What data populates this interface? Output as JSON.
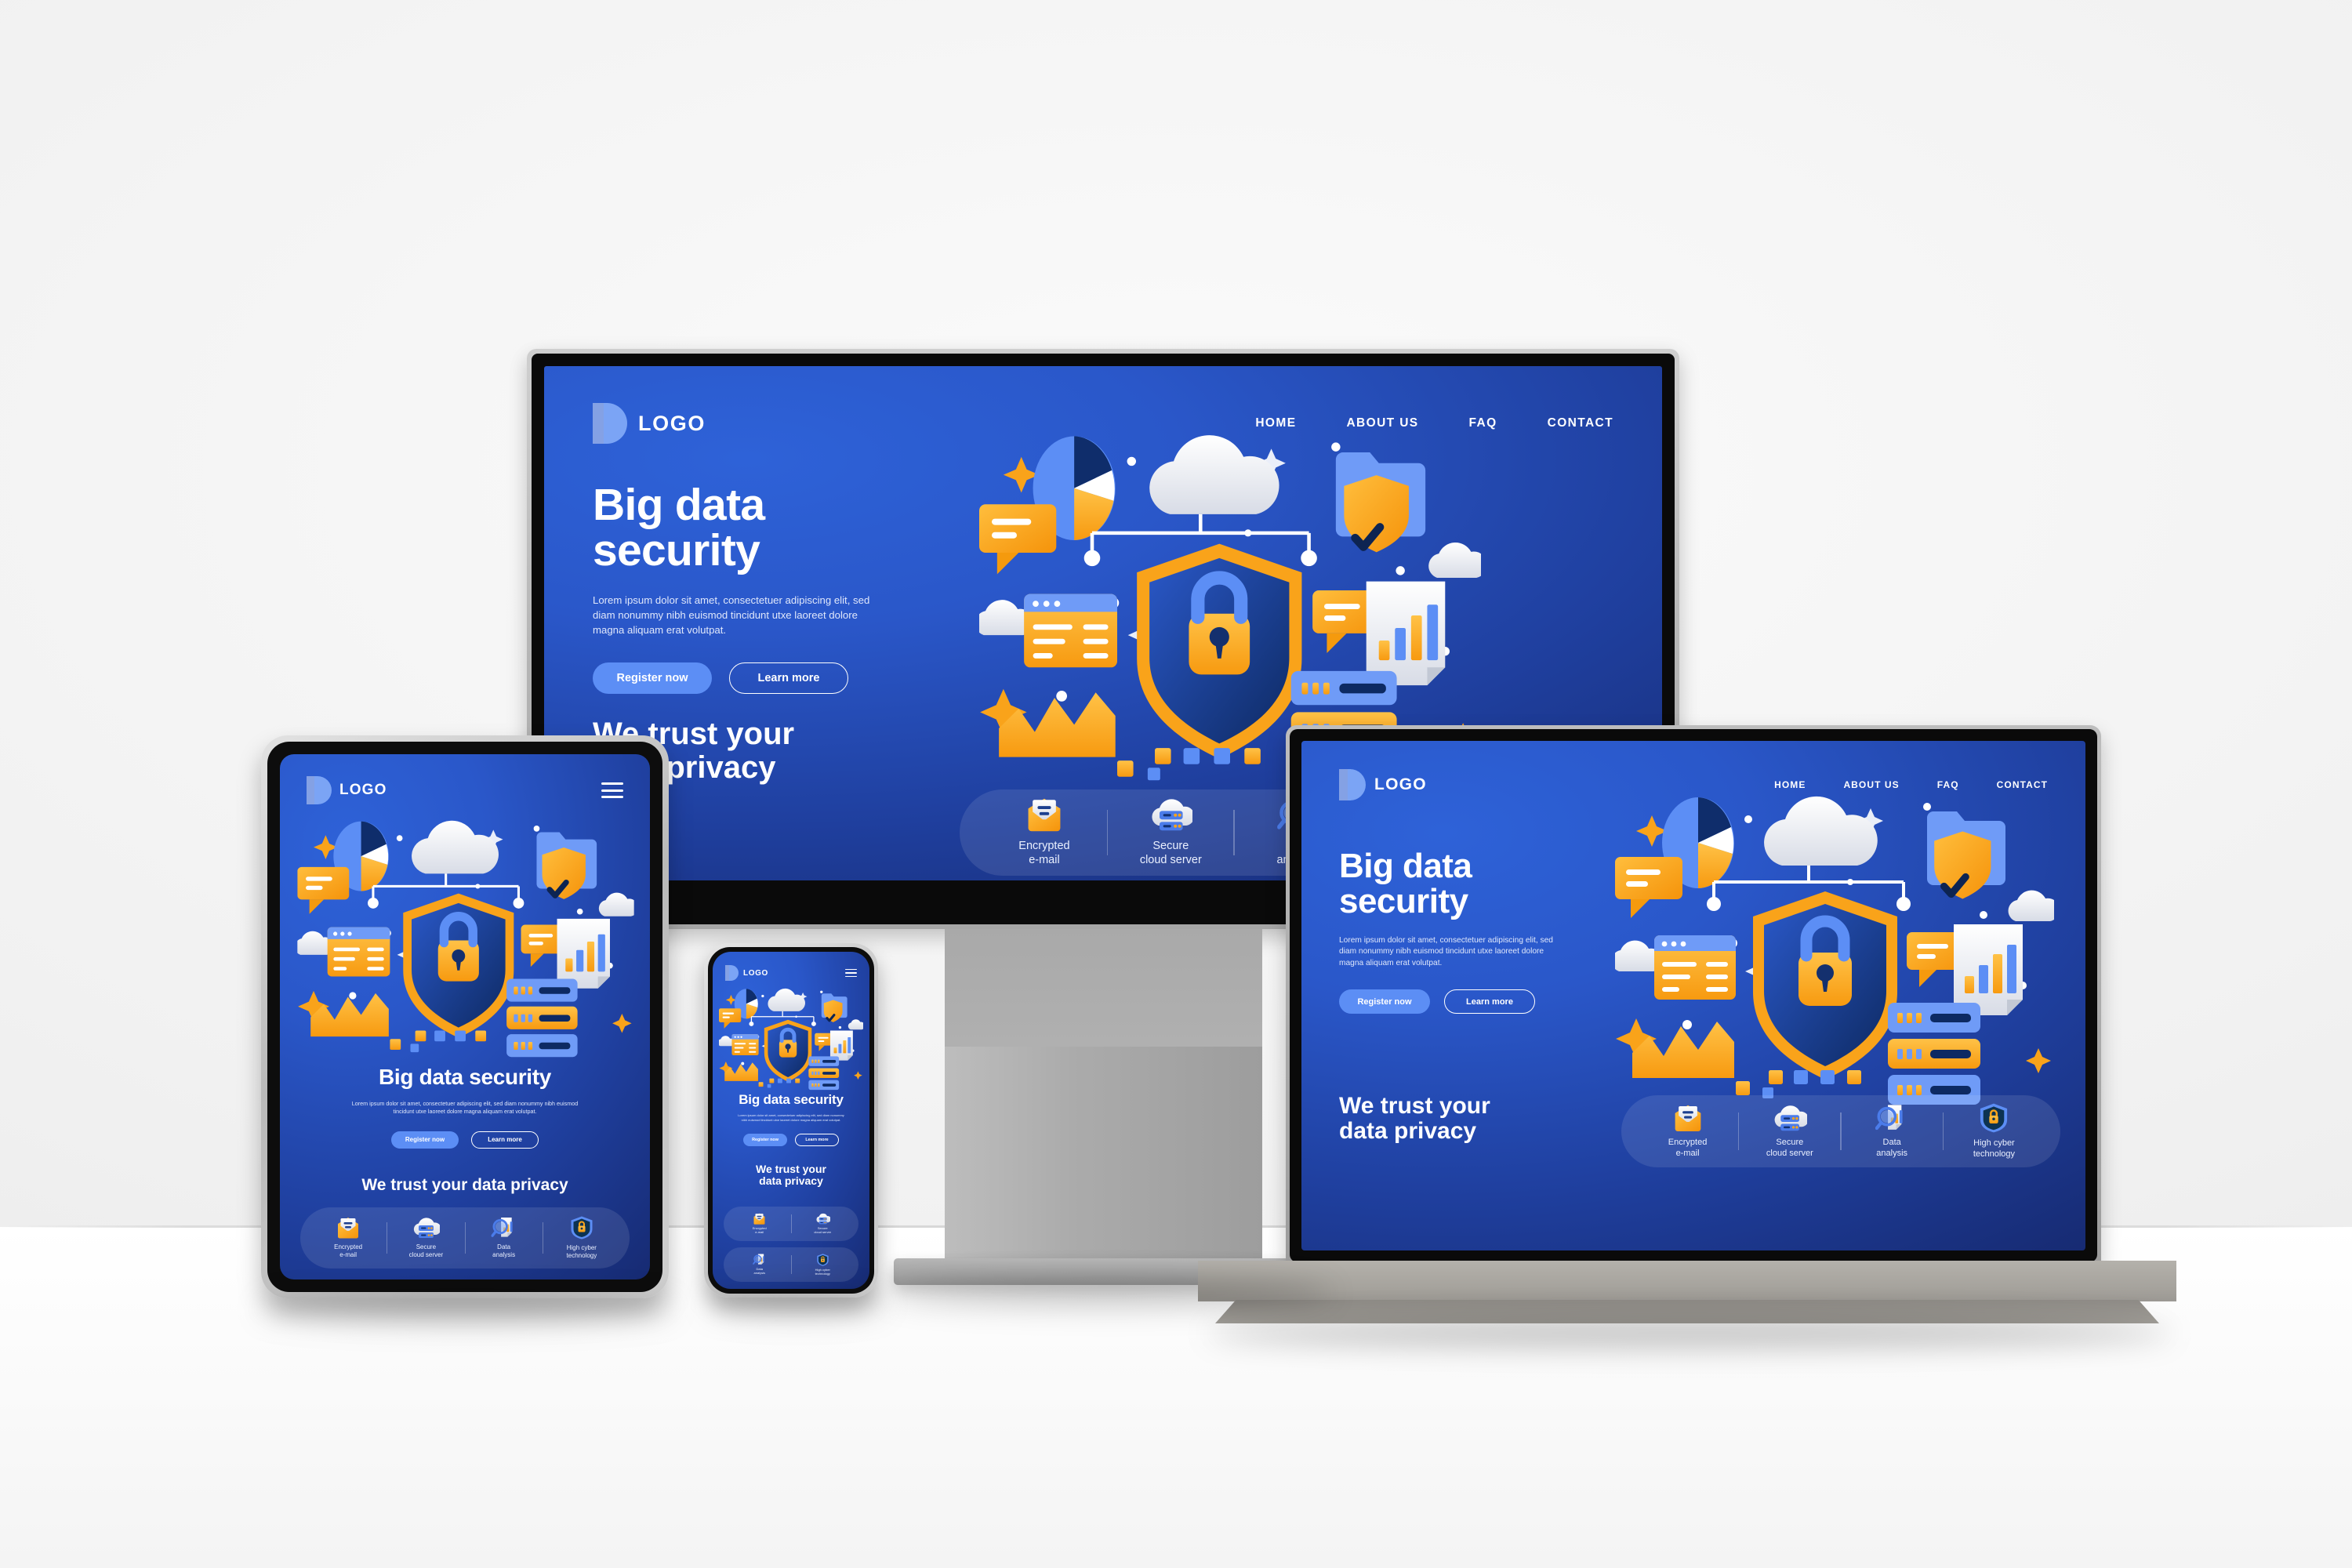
{
  "brand": {
    "logo_text": "LOGO",
    "logo_icon": "letter-d-logo-icon",
    "accent_blue": "#5c8ef5",
    "accent_orange": "#f7a81b",
    "page_bg_from": "#2e62d8",
    "page_bg_to": "#16296f"
  },
  "nav": {
    "items": [
      {
        "label": "HOME"
      },
      {
        "label": "ABOUT US"
      },
      {
        "label": "FAQ"
      },
      {
        "label": "CONTACT"
      }
    ],
    "menu_icon": "hamburger-menu-icon"
  },
  "hero": {
    "title_line1": "Big data",
    "title_line2": "security",
    "title_single": "Big data security",
    "paragraph": "Lorem ipsum dolor sit amet, consectetuer adipiscing elit, sed diam nonummy nibh euismod tincidunt utxe laoreet dolore magna aliquam erat volutpat.",
    "primary_cta": "Register now",
    "secondary_cta": "Learn more"
  },
  "subhead": {
    "line1": "We trust your",
    "line2": "data privacy",
    "single": "We trust your data privacy"
  },
  "features": [
    {
      "label_line1": "Encrypted",
      "label_line2": "e-mail",
      "icon": "envelope-mail-icon"
    },
    {
      "label_line1": "Secure",
      "label_line2": "cloud server",
      "icon": "cloud-server-icon"
    },
    {
      "label_line1": "Data",
      "label_line2": "analysis",
      "icon": "magnifier-chart-icon"
    },
    {
      "label_line1": "High cyber",
      "label_line2": "technology",
      "icon": "shield-lock-icon"
    }
  ],
  "illustration": {
    "elements": [
      "pie-chart-icon",
      "cloud-icon",
      "folder-shield-check-icon",
      "chat-bubble-icon",
      "browser-window-icon",
      "area-chart-icon",
      "central-shield-padlock-icon",
      "bar-chart-document-icon",
      "server-rack-icon",
      "sparkle-icon",
      "dot-icon"
    ]
  },
  "devices": [
    {
      "name": "desktop-monitor",
      "frame": "#b6b6b6",
      "bezel": "#0a0a0a"
    },
    {
      "name": "tablet",
      "frame": "#c9c9c9",
      "bezel": "#0d0d0d"
    },
    {
      "name": "smartphone",
      "frame": "#c9c9c9",
      "bezel": "#0d0d0d"
    },
    {
      "name": "laptop",
      "frame": "#9f9f9f",
      "bezel": "#0a0a0a"
    }
  ]
}
